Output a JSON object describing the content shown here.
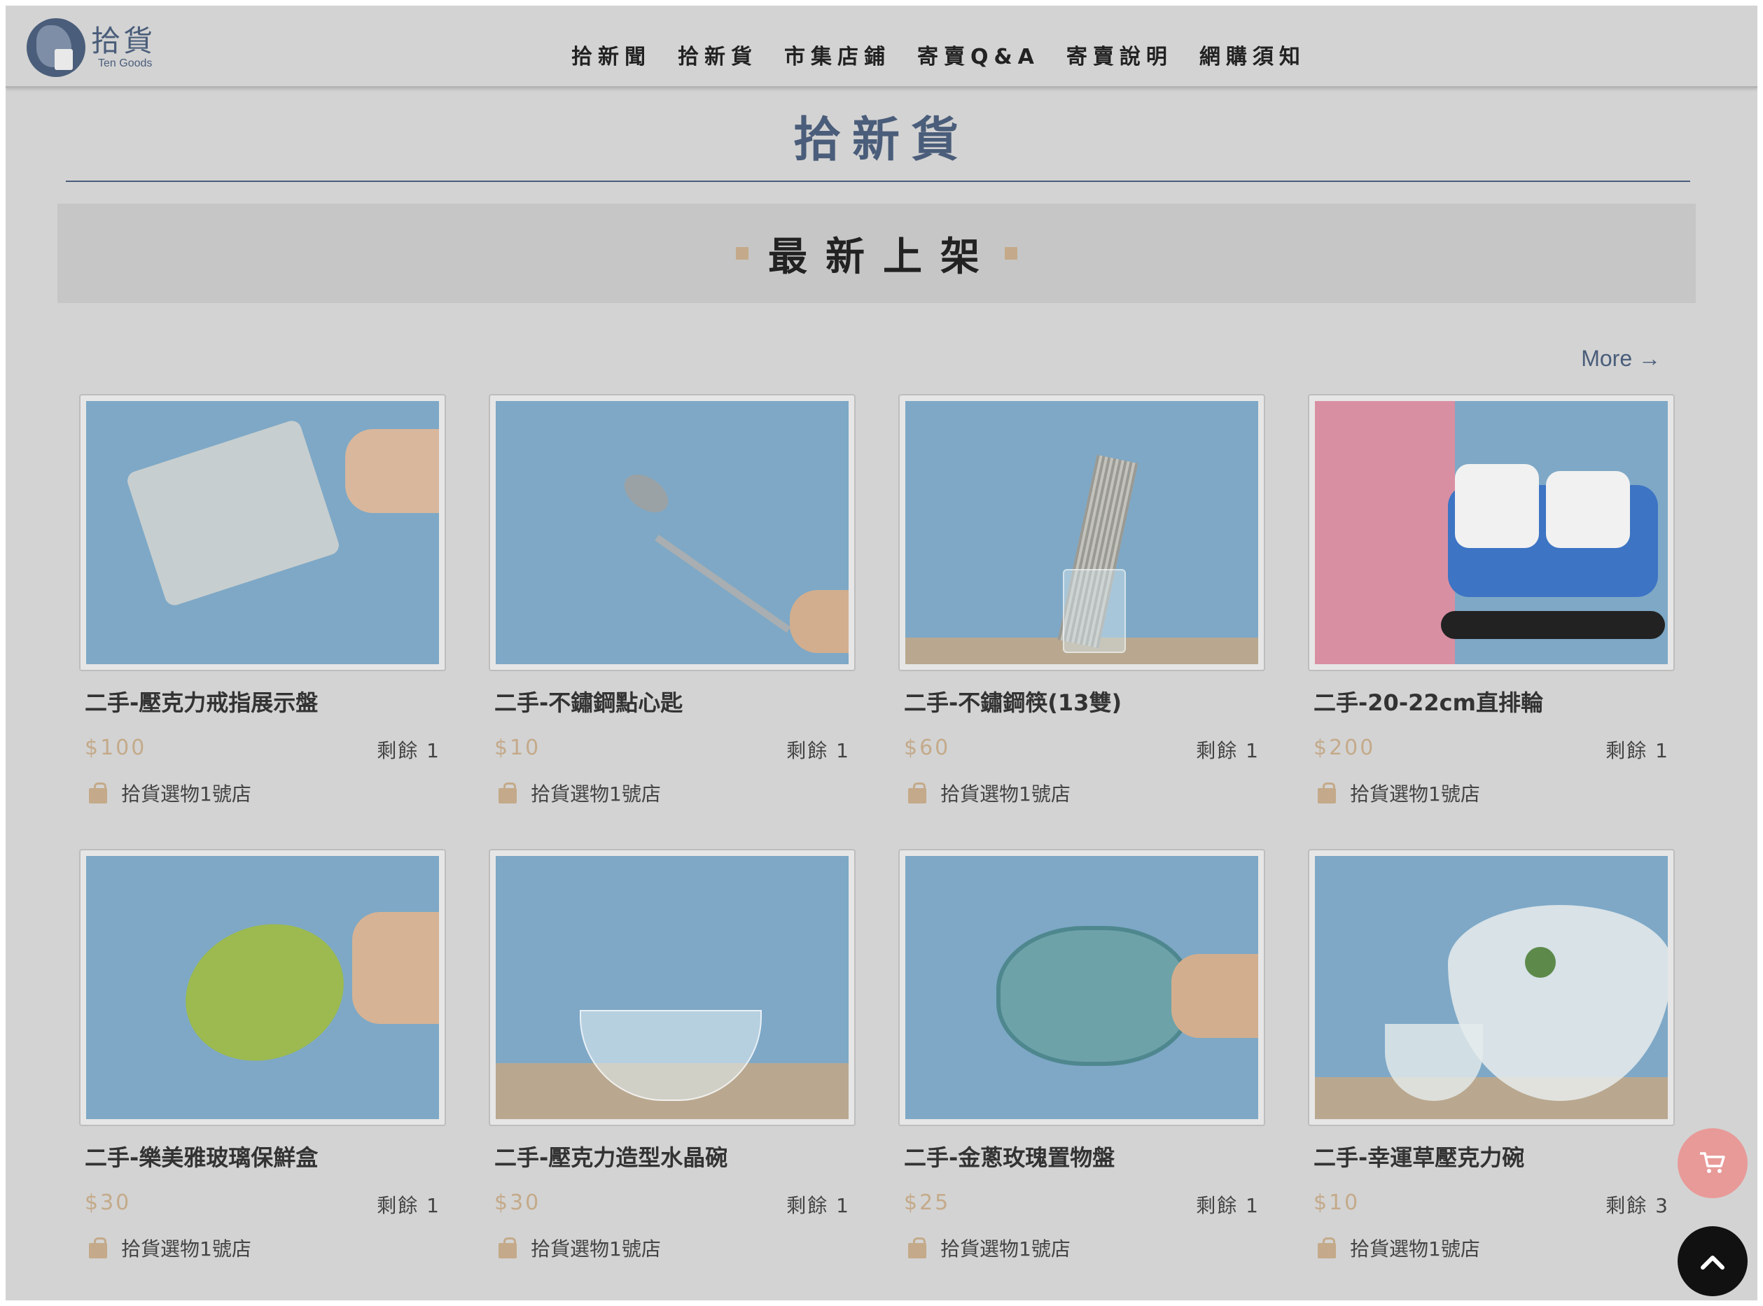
{
  "header": {
    "logo_zh": "拾貨",
    "logo_en": "Ten Goods",
    "nav": [
      "拾新聞",
      "拾新貨",
      "市集店鋪",
      "寄賣Q&A",
      "寄賣說明",
      "網購須知"
    ]
  },
  "page_title": "拾新貨",
  "section_title": "最新上架",
  "more_label": "More →",
  "products": [
    {
      "name": "二手-壓克力戒指展示盤",
      "price": "$100",
      "stock": "剩餘 1",
      "shop": "拾貨選物1號店",
      "image": "acrylic-ring-tray-photo"
    },
    {
      "name": "二手-不鏽鋼點心匙",
      "price": "$10",
      "stock": "剩餘 1",
      "shop": "拾貨選物1號店",
      "image": "steel-spoon-photo"
    },
    {
      "name": "二手-不鏽鋼筷(13雙)",
      "price": "$60",
      "stock": "剩餘 1",
      "shop": "拾貨選物1號店",
      "image": "steel-chopsticks-photo"
    },
    {
      "name": "二手-20-22cm直排輪",
      "price": "$200",
      "stock": "剩餘 1",
      "shop": "拾貨選物1號店",
      "image": "inline-skates-photo"
    },
    {
      "name": "二手-樂美雅玻璃保鮮盒",
      "price": "$30",
      "stock": "剩餘 1",
      "shop": "拾貨選物1號店",
      "image": "glass-container-photo"
    },
    {
      "name": "二手-壓克力造型水晶碗",
      "price": "$30",
      "stock": "剩餘 1",
      "shop": "拾貨選物1號店",
      "image": "crystal-bowl-photo"
    },
    {
      "name": "二手-金蔥玫瑰置物盤",
      "price": "$25",
      "stock": "剩餘 1",
      "shop": "拾貨選物1號店",
      "image": "rose-glass-plate-photo"
    },
    {
      "name": "二手-幸運草壓克力碗",
      "price": "$10",
      "stock": "剩餘 3",
      "shop": "拾貨選物1號店",
      "image": "clover-acrylic-bowl-photo"
    }
  ],
  "icons": {
    "cart": "cart-icon",
    "back_to_top": "chevron-up-icon",
    "shop": "gift-bag-icon"
  },
  "colors": {
    "brand": "#4a5d7a",
    "price": "#c4aa8a",
    "background": "#d3d3d3",
    "cart_button": "#e89a98",
    "top_button": "#111111"
  }
}
